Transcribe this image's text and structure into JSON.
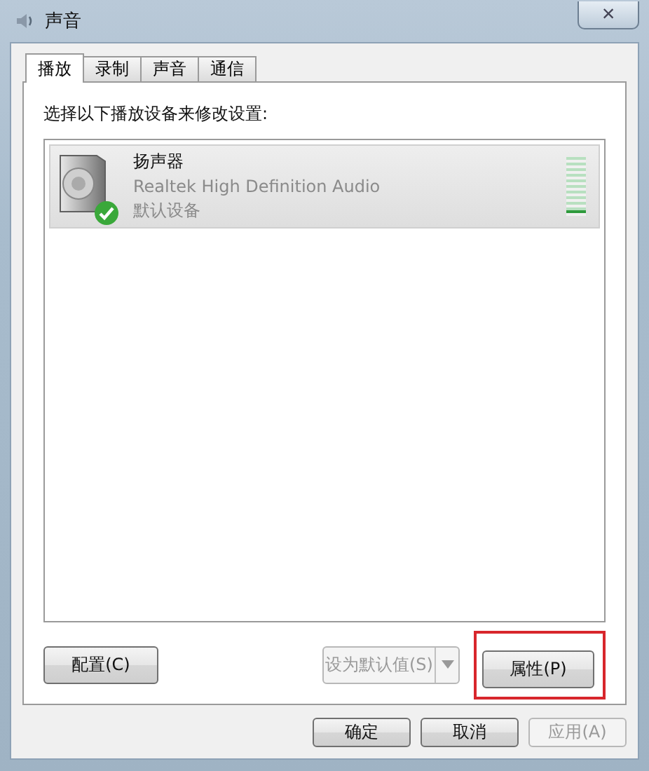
{
  "window": {
    "title": "声音",
    "close": "×"
  },
  "tabs": [
    {
      "label": "播放",
      "selected": true
    },
    {
      "label": "录制",
      "selected": false
    },
    {
      "label": "声音",
      "selected": false
    },
    {
      "label": "通信",
      "selected": false
    }
  ],
  "instruction": "选择以下播放设备来修改设置:",
  "devices": [
    {
      "name": "扬声器",
      "driver": "Realtek High Definition Audio",
      "status": "默认设备",
      "selected": true,
      "is_default": true,
      "level": 0.1
    }
  ],
  "panel_buttons": [
    {
      "label": "配置(C)",
      "kind": "plain",
      "disabled": false,
      "highlighted": false
    },
    {
      "label": "设为默认值(S)",
      "kind": "split",
      "disabled": true,
      "highlighted": false
    },
    {
      "label": "属性(P)",
      "kind": "plain",
      "disabled": false,
      "highlighted": true
    }
  ],
  "dialog_buttons": [
    {
      "label": "确定",
      "disabled": false
    },
    {
      "label": "取消",
      "disabled": false
    },
    {
      "label": "应用(A)",
      "disabled": true
    }
  ]
}
